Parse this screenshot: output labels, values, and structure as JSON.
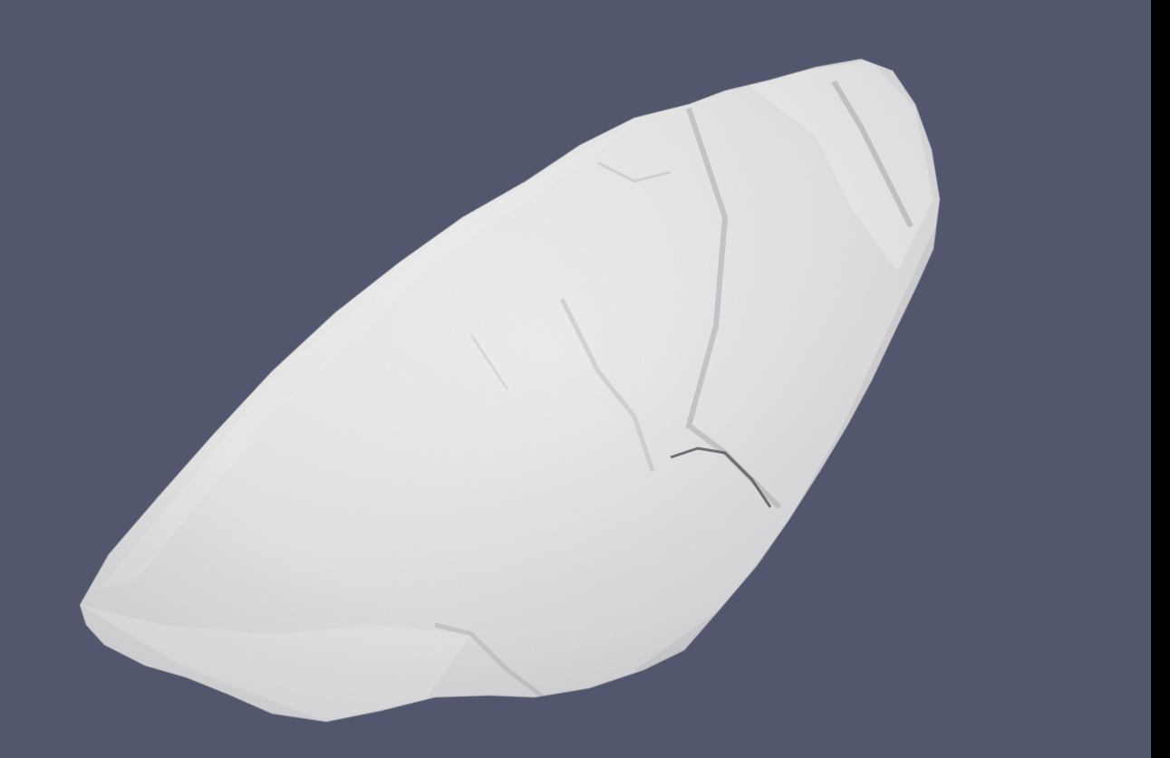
{
  "viewport": {
    "background_color": "#52576e",
    "side_strip_color": "#000000"
  },
  "model": {
    "surface_color": "#e6e6e6",
    "highlight_color": "#f7f7f7",
    "shadow_color": "#a9a9ac",
    "crease_color": "#4a4a52"
  }
}
